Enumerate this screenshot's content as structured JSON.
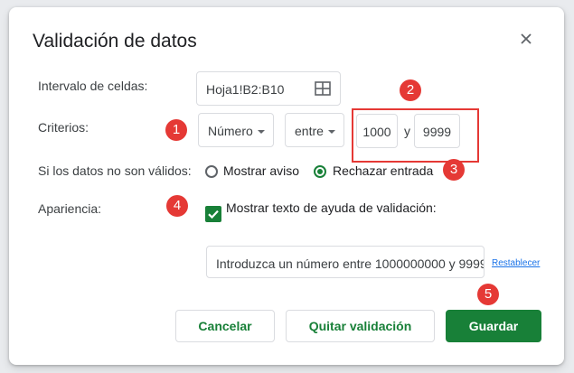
{
  "dialog": {
    "title": "Validación de datos"
  },
  "range": {
    "label": "Intervalo de celdas:",
    "value": "Hoja1!B2:B10"
  },
  "criteria": {
    "label": "Criterios:",
    "type_value": "Número",
    "condition_value": "entre",
    "min_value": "1000",
    "and_label": "y",
    "max_value": "9999"
  },
  "invalid": {
    "label": "Si los datos no son válidos:",
    "options": [
      {
        "label": "Mostrar aviso",
        "selected": false
      },
      {
        "label": "Rechazar entrada",
        "selected": true
      }
    ]
  },
  "appearance": {
    "label": "Apariencia:",
    "checkbox_label": "Mostrar texto de ayuda de validación:",
    "checked": true,
    "help_text": "Introduzca un número entre 1000000000 y 9999",
    "reset_label": "Restablecer"
  },
  "buttons": {
    "cancel": "Cancelar",
    "remove": "Quitar validación",
    "save": "Guardar"
  },
  "annotations": [
    "1",
    "2",
    "3",
    "4",
    "5"
  ],
  "colors": {
    "accent_green": "#188038",
    "annotation_red": "#e53935",
    "link_blue": "#1a73e8"
  }
}
